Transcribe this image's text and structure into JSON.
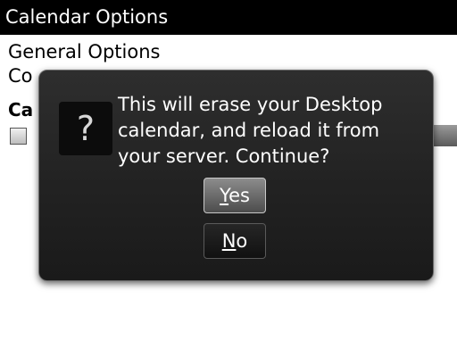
{
  "titlebar": {
    "title": "Calendar Options"
  },
  "list": {
    "general_options": "General Options",
    "conflict_item_partial": "Co",
    "calendar_partial": "Ca"
  },
  "dialog": {
    "icon": "question-icon",
    "icon_glyph": "?",
    "message": "This will erase your Desktop\ncalendar, and reload it from\nyour server.  Continue?",
    "yes": {
      "mnemonic": "Y",
      "rest": "es"
    },
    "no": {
      "mnemonic": "N",
      "rest": "o"
    }
  }
}
